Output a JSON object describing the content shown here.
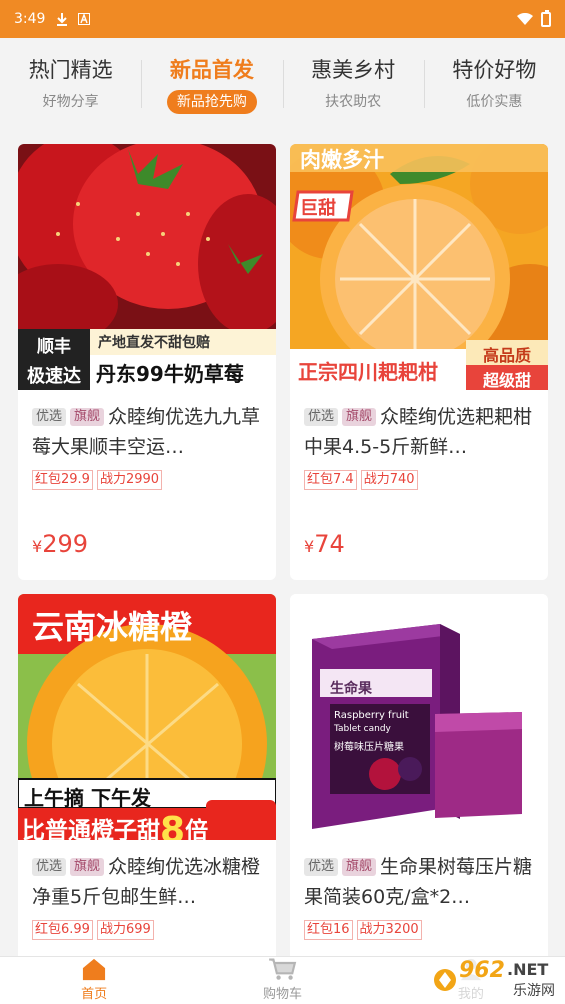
{
  "statusbar": {
    "time": "3:49"
  },
  "tabs": [
    {
      "title": "热门精选",
      "subtitle": "好物分享",
      "active": false
    },
    {
      "title": "新品首发",
      "subtitle": "新品抢先购",
      "active": true
    },
    {
      "title": "惠美乡村",
      "subtitle": "扶农助农",
      "active": false
    },
    {
      "title": "特价好物",
      "subtitle": "低价实惠",
      "active": false
    }
  ],
  "products": [
    {
      "image_text": {
        "line1": "产地直发不甜包赔",
        "badge1": "顺丰",
        "badge2": "极速达",
        "line2": "丹东99牛奶草莓"
      },
      "tag1": "优选",
      "tag2": "旗舰",
      "title": "众睦绚优选九九草莓大果顺丰空运…",
      "chip1": "红包29.9",
      "chip2": "战力2990",
      "price_symbol": "¥",
      "price": "299"
    },
    {
      "image_text": {
        "top": "肉嫩多汁",
        "sticker": "巨甜",
        "line1": "正宗四川耙耙柑",
        "badge1": "高品质",
        "badge2": "超级甜"
      },
      "tag1": "优选",
      "tag2": "旗舰",
      "title": "众睦绚优选耙耙柑中果4.5-5斤新鲜…",
      "chip1": "红包7.4",
      "chip2": "战力740",
      "price_symbol": "¥",
      "price": "74"
    },
    {
      "image_text": {
        "top": "云南冰糖橙",
        "line1": "上午摘 下午发",
        "line2a": "比普通橙子甜",
        "line2b": "8",
        "line2c": "倍"
      },
      "tag1": "优选",
      "tag2": "旗舰",
      "title": "众睦绚优选冰糖橙净重5斤包邮生鲜…",
      "chip1": "红包6.99",
      "chip2": "战力699"
    },
    {
      "image_text": {
        "brand": "生命果",
        "product": "Raspberry fruit",
        "sub": "Tablet candy",
        "cn": "树莓味压片糖果"
      },
      "tag1": "优选",
      "tag2": "旗舰",
      "title": "生命果树莓压片糖果简装60克/盒*2…",
      "chip1": "红包16",
      "chip2": "战力3200"
    }
  ],
  "tabbar": [
    {
      "label": "首页",
      "icon": "home-icon",
      "active": true
    },
    {
      "label": "购物车",
      "icon": "cart-icon",
      "active": false
    },
    {
      "label": "我的",
      "icon": "user-icon",
      "active": false
    }
  ],
  "watermark": {
    "text1": "962",
    "text2": ".NET",
    "text3": "乐游网"
  },
  "colors": {
    "accent": "#ef7d1d",
    "price": "#e8443b",
    "statusbar": "#f08a24"
  }
}
